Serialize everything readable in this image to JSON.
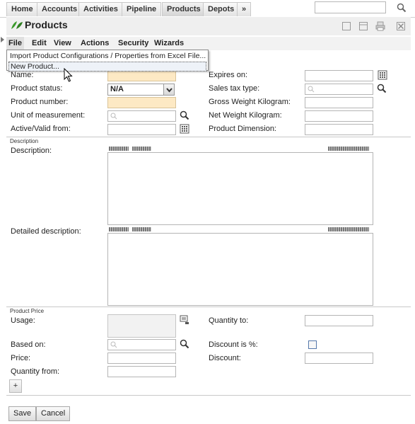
{
  "nav": {
    "tabs": [
      "Home",
      "Accounts",
      "Activities",
      "Pipeline",
      "Products",
      "Depots",
      "»"
    ],
    "active_tab": "Products",
    "search_value": ""
  },
  "header": {
    "title": "Products"
  },
  "menubar": {
    "items": [
      "File",
      "Edit",
      "View",
      "Actions",
      "Security",
      "Wizards"
    ]
  },
  "file_menu": {
    "items": [
      "Import Product Configurations / Properties from Excel File...",
      "New Product..."
    ],
    "hovered": "New Product..."
  },
  "form": {
    "name_label": "Name:",
    "expires_label": "Expires on:",
    "status_label": "Product status:",
    "status_value": "N/A",
    "sales_tax_label": "Sales tax type:",
    "product_number_label": "Product number:",
    "gross_weight_label": "Gross Weight Kilogram:",
    "uom_label": "Unit of measurement:",
    "net_weight_label": "Net Weight Kilogram:",
    "active_from_label": "Active/Valid from:",
    "dimension_label": "Product Dimension:",
    "description_section": "Description",
    "description_label": "Description:",
    "detailed_description_label": "Detailed description:",
    "price_section": "Product Price",
    "usage_label": "Usage:",
    "quantity_to_label": "Quantity to:",
    "based_on_label": "Based on:",
    "discount_pct_label": "Discount is %:",
    "price_label": "Price:",
    "discount_label": "Discount:",
    "quantity_from_label": "Quantity from:",
    "add_label": "+"
  },
  "actions": {
    "save_label": "Save",
    "cancel_label": "Cancel"
  },
  "colors": {
    "required_field": "#fde9c4",
    "header_bg": "#efefef",
    "logo_green": "#3a9a2a"
  }
}
